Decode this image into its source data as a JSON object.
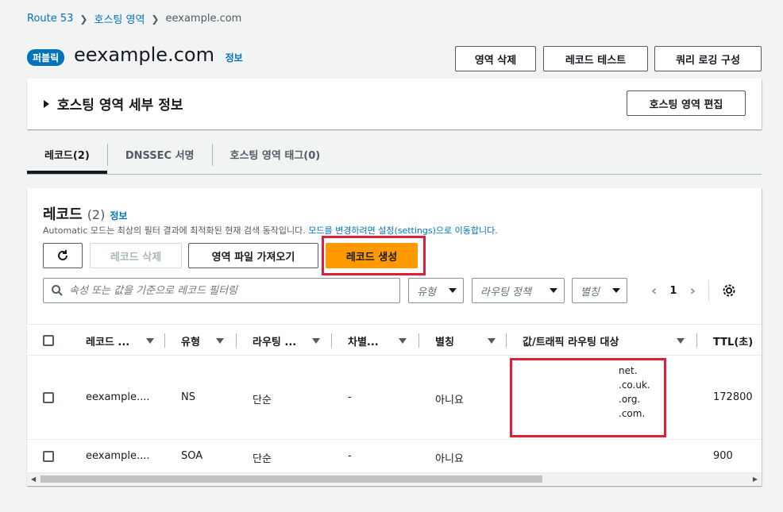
{
  "breadcrumb": {
    "items": [
      "Route 53",
      "호스팅 영역"
    ],
    "current": "eexample.com"
  },
  "header": {
    "badge": "퍼블릭",
    "title": "eexample.com",
    "info": "정보",
    "buttons": {
      "delete_zone": "영역 삭제",
      "test_record": "레코드 테스트",
      "query_logging": "쿼리 로깅 구성"
    }
  },
  "details": {
    "title": "호스팅 영역 세부 정보",
    "edit_button": "호스팅 영역 편집"
  },
  "tabs": [
    {
      "label": "레코드(2)"
    },
    {
      "label": "DNSSEC 서명"
    },
    {
      "label": "호스팅 영역 태그(0)"
    }
  ],
  "records": {
    "title": "레코드",
    "count": "(2)",
    "info": "정보",
    "desc_prefix": "Automatic 모드는 최상의 필터 결과에 최적화된 현재 검색 동작입니다. ",
    "desc_link": "모드를 변경하려면 설정(settings)으로 이동합니다.",
    "buttons": {
      "delete": "레코드 삭제",
      "import": "영역 파일 가져오기",
      "create": "레코드 생성"
    },
    "search_placeholder": "속성 또는 값을 기준으로 레코드 필터링",
    "filters": {
      "type": "유형",
      "routing": "라우팅 정책",
      "alias": "별칭"
    },
    "page": "1",
    "columns": [
      "레코드 ...",
      "유형",
      "라우팅 ...",
      "차별...",
      "별칭",
      "값/트래픽 라우팅 대상",
      "TTL(초)"
    ],
    "rows": [
      {
        "name": "eexample....",
        "type": "NS",
        "routing": "단순",
        "diff": "-",
        "alias": "아니요",
        "values": [
          "net.",
          ".co.uk.",
          ".org.",
          ".com."
        ],
        "ttl": "172800"
      },
      {
        "name": "eexample....",
        "type": "SOA",
        "routing": "단순",
        "diff": "-",
        "alias": "아니요",
        "values": [],
        "ttl": "900"
      }
    ]
  },
  "colors": {
    "accent": "#0073bb",
    "primary": "#ff9900",
    "highlight": "#e01e37"
  }
}
